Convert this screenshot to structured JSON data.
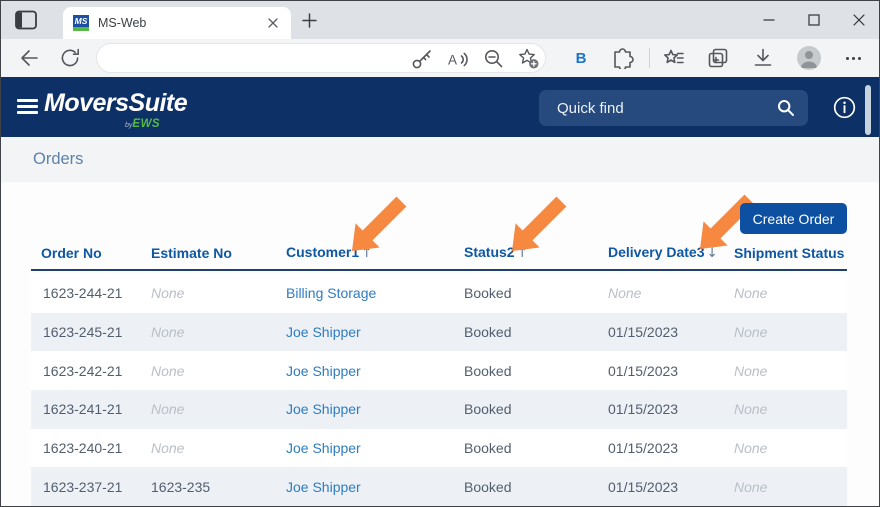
{
  "window": {
    "tab_title": "MS-Web",
    "favicon_text": "MS"
  },
  "browser_toolbar": {
    "address_value": "",
    "bing_label": "B"
  },
  "app_header": {
    "logo_text": "MoversSuite",
    "logo_by": "by",
    "logo_brand": "EWS",
    "quick_find_placeholder": "Quick find"
  },
  "page": {
    "title": "Orders",
    "create_order_label": "Create Order"
  },
  "orders_table": {
    "columns": [
      {
        "label": "Order No"
      },
      {
        "label": "Estimate No"
      },
      {
        "label": "Customer",
        "sort_rank": "1",
        "sort_dir": "asc"
      },
      {
        "label": "Status",
        "sort_rank": "2",
        "sort_dir": "asc"
      },
      {
        "label": "Delivery Date",
        "sort_rank": "3",
        "sort_dir": "desc"
      },
      {
        "label": "Shipment Status"
      }
    ],
    "rows": [
      [
        "1623-244-21",
        "None",
        "Billing Storage",
        "Booked",
        "None",
        "None"
      ],
      [
        "1623-245-21",
        "None",
        "Joe Shipper",
        "Booked",
        "01/15/2023",
        "None"
      ],
      [
        "1623-242-21",
        "None",
        "Joe Shipper",
        "Booked",
        "01/15/2023",
        "None"
      ],
      [
        "1623-241-21",
        "None",
        "Joe Shipper",
        "Booked",
        "01/15/2023",
        "None"
      ],
      [
        "1623-240-21",
        "None",
        "Joe Shipper",
        "Booked",
        "01/15/2023",
        "None"
      ],
      [
        "1623-237-21",
        "1623-235",
        "Joe Shipper",
        "Booked",
        "01/15/2023",
        "None"
      ]
    ],
    "empty_value_text": "None"
  },
  "annotations": {
    "arrows": [
      {
        "points_at": "Customer sort indicator 1"
      },
      {
        "points_at": "Status sort indicator 2"
      },
      {
        "points_at": "Delivery Date sort indicator 3"
      }
    ]
  },
  "colors": {
    "header_navy": "#0D3166",
    "button_blue": "#0D4FA0",
    "column_header_blue": "#0D57A3",
    "link_blue": "#2E7CC2",
    "brand_green": "#58B847",
    "annotation_orange": "#F6883F",
    "row_stripe": "#EDF1F6"
  }
}
